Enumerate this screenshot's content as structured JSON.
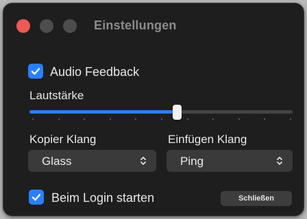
{
  "window": {
    "title": "Einstellungen"
  },
  "audio_feedback": {
    "label": "Audio Feedback",
    "checked": true
  },
  "volume": {
    "label": "Lautstärke",
    "value_fraction": 0.56
  },
  "copy_sound": {
    "label": "Kopier Klang",
    "value": "Glass"
  },
  "paste_sound": {
    "label": "Einfügen Klang",
    "value": "Ping"
  },
  "start_at_login": {
    "label": "Beim Login starten",
    "checked": true
  },
  "close_button": {
    "label": "Schließen"
  },
  "colors": {
    "accent": "#2a7fff",
    "close_light": "#ed5a55",
    "background": "#1e1e1e"
  }
}
